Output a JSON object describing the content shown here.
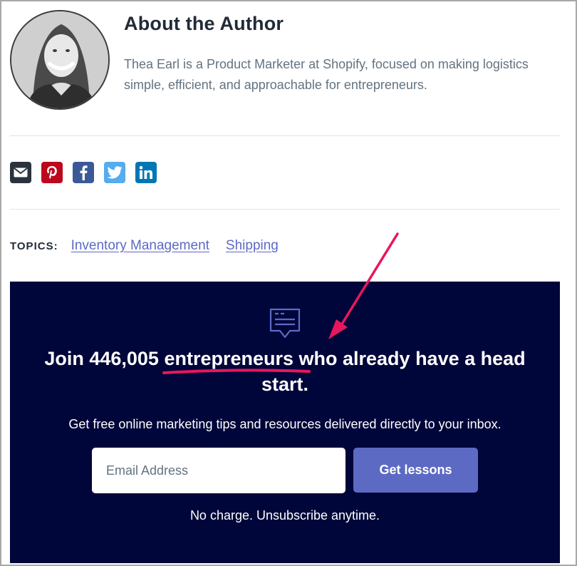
{
  "author": {
    "title": "About the Author",
    "bio": "Thea Earl is a Product Marketer at Shopify, focused on making logistics simple, efficient, and approachable for entrepreneurs."
  },
  "share": [
    {
      "name": "email",
      "icon": "envelope-icon",
      "color": "#2a333d"
    },
    {
      "name": "pinterest",
      "icon": "pinterest-icon",
      "color": "#bd081c"
    },
    {
      "name": "facebook",
      "icon": "facebook-icon",
      "color": "#3b5998"
    },
    {
      "name": "twitter",
      "icon": "twitter-icon",
      "color": "#55acee"
    },
    {
      "name": "linkedin",
      "icon": "linkedin-icon",
      "color": "#0077b5"
    }
  ],
  "topics": {
    "label": "TOPICS:",
    "links": [
      "Inventory Management",
      "Shipping"
    ]
  },
  "newsletter": {
    "headline_line1": "Join 446,005 entrepreneurs who already have a head",
    "headline_line2": "start.",
    "subtext": "Get free online marketing tips and resources delivered directly to your inbox.",
    "email_placeholder": "Email Address",
    "button_label": "Get lessons",
    "note": "No charge. Unsubscribe anytime."
  },
  "colors": {
    "accent": "#5c6ac4",
    "newsletter_bg": "#000639",
    "annotation": "#e8175d"
  }
}
